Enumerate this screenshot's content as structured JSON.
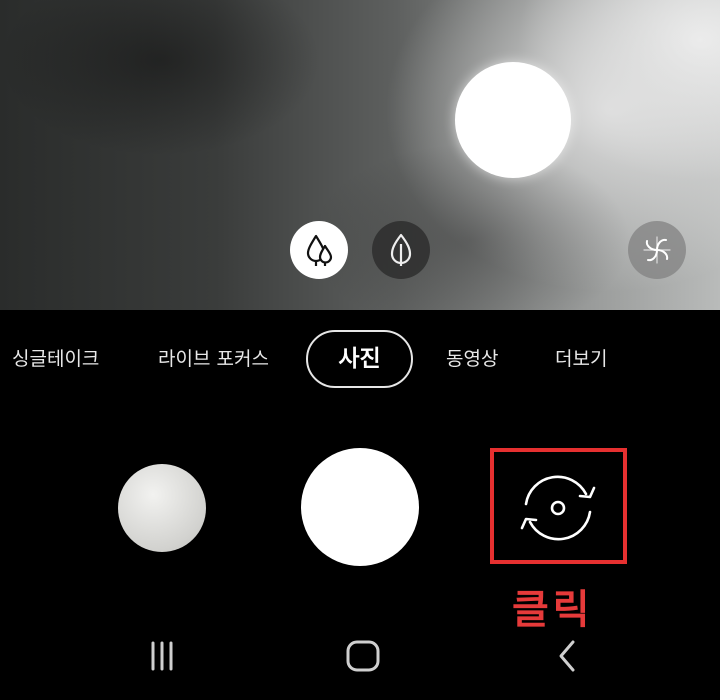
{
  "camera": {
    "modes": [
      {
        "label": "싱글테이크"
      },
      {
        "label": "라이브 포커스"
      },
      {
        "label": "사진"
      },
      {
        "label": "동영상"
      },
      {
        "label": "더보기"
      }
    ],
    "selected_mode": "사진",
    "icons": {
      "scene_optimizer_active": "water-drops-icon",
      "scene_optimizer_alt": "leaf-icon",
      "effects": "effects-pinwheel-icon",
      "flip": "camera-flip-icon"
    }
  },
  "annotation": {
    "label": "클릭",
    "color": "#e63030"
  },
  "navigation": {
    "recent": "recent-apps-icon",
    "home": "home-icon",
    "back": "back-icon"
  }
}
